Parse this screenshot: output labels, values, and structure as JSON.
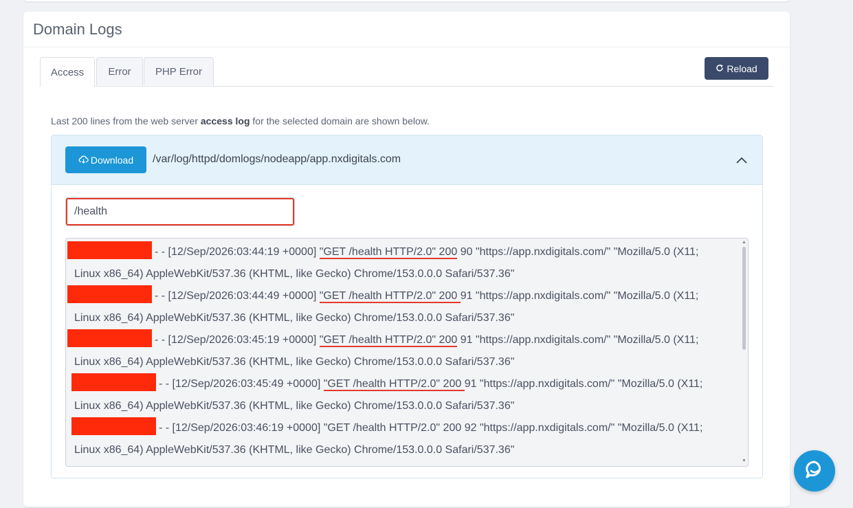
{
  "card": {
    "title": "Domain Logs"
  },
  "tabs": [
    {
      "label": "Access",
      "active": true
    },
    {
      "label": "Error",
      "active": false
    },
    {
      "label": "PHP Error",
      "active": false
    }
  ],
  "reload_label": "Reload",
  "description": {
    "prefix": "Last 200 lines from the web server ",
    "bold": "access log",
    "suffix": " for the selected domain are shown below."
  },
  "log_panel": {
    "download_label": "Download",
    "path": "/var/log/httpd/domlogs/nodeapp/app.nxdigitals.com"
  },
  "filter": {
    "value": "/health"
  },
  "log_entries": [
    {
      "pre": "- - [12/Sep/2026:03:44:19 +0000] ",
      "request": "\"GET /health HTTP/2.0\" 200",
      "post": " 90 \"https://app.nxdigitals.com/\" \"Mozilla/5.0 (X11;",
      "cont": "Linux x86_64) AppleWebKit/537.36 (KHTML, like Gecko) Chrome/153.0.0.0 Safari/537.36\""
    },
    {
      "pre": "- - [12/Sep/2026:03:44:49 +0000] ",
      "request": "\"GET /health HTTP/2.0\" 200 ",
      "post": "91 \"https://app.nxdigitals.com/\" \"Mozilla/5.0 (X11;",
      "cont": "Linux x86_64) AppleWebKit/537.36 (KHTML, like Gecko) Chrome/153.0.0.0 Safari/537.36\""
    },
    {
      "pre": "- - [12/Sep/2026:03:45:19 +0000] ",
      "request": "\"GET /health HTTP/2.0\" 200",
      "post": " 91 \"https://app.nxdigitals.com/\" \"Mozilla/5.0 (X11;",
      "cont": "Linux x86_64) AppleWebKit/537.36 (KHTML, like Gecko) Chrome/153.0.0.0 Safari/537.36\""
    },
    {
      "pre": "- - [12/Sep/2026:03:45:49 +0000] ",
      "request": "\"GET /health HTTP/2.0\" 200 ",
      "post": "91 \"https://app.nxdigitals.com/\" \"Mozilla/5.0 (X11;",
      "cont": "Linux x86_64) AppleWebKit/537.36 (KHTML, like Gecko) Chrome/153.0.0.0 Safari/537.36\""
    },
    {
      "pre": "- - [12/Sep/2026:03:46:19 +0000] ",
      "request": "\"GET /health HTTP/2.0\" 200",
      "post": " 92 \"https://app.nxdigitals.com/\" \"Mozilla/5.0 (X11;",
      "cont": "Linux x86_64) AppleWebKit/537.36 (KHTML, like Gecko) Chrome/153.0.0.0 Safari/537.36\""
    }
  ],
  "highlighted_entries": [
    0,
    1,
    2,
    3
  ],
  "colors": {
    "accent": "#1c96d6",
    "reload": "#3b4a6b",
    "redaction": "#ff2a0a",
    "highlight": "#e53a2a"
  },
  "icons": {
    "reload": "refresh-icon",
    "download": "cloud-download-icon",
    "collapse": "chevron-up-icon",
    "chat": "chat-bubble-icon"
  }
}
